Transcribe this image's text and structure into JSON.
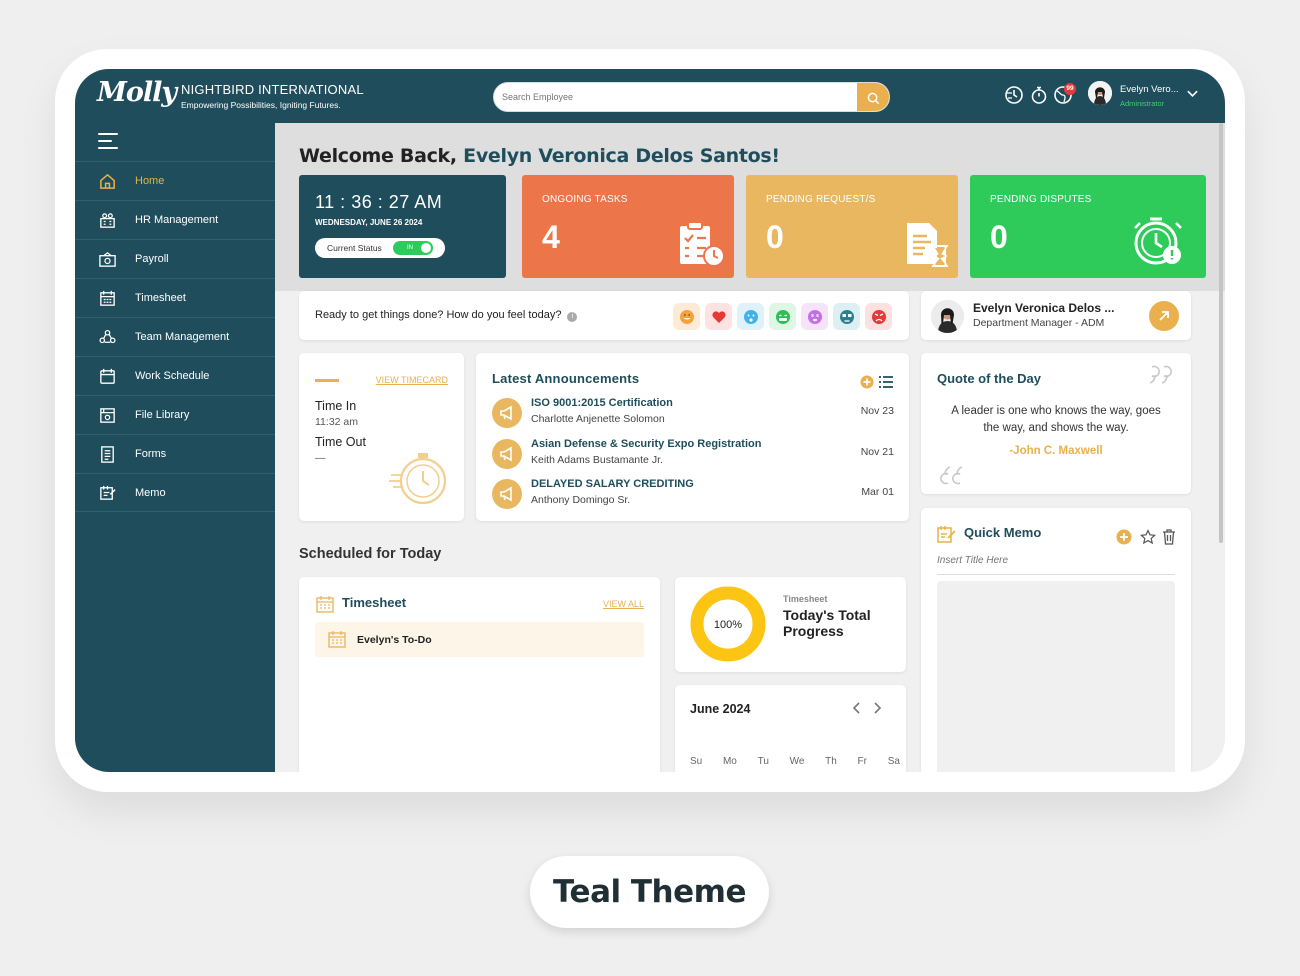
{
  "header": {
    "logo": "Molly",
    "company": "NIGHTBIRD INTERNATIONAL",
    "tagline": "Empowering Possibilities, Igniting Futures.",
    "search_placeholder": "Search Employee",
    "notification_count": "99",
    "user_name": "Evelyn Vero...",
    "user_role": "Administrator"
  },
  "sidebar": {
    "items": [
      {
        "label": "Home",
        "icon": "home-icon"
      },
      {
        "label": "HR Management",
        "icon": "hr-icon"
      },
      {
        "label": "Payroll",
        "icon": "payroll-icon"
      },
      {
        "label": "Timesheet",
        "icon": "timesheet-icon"
      },
      {
        "label": "Team Management",
        "icon": "team-icon"
      },
      {
        "label": "Work Schedule",
        "icon": "calendar-icon"
      },
      {
        "label": "File Library",
        "icon": "file-library-icon"
      },
      {
        "label": "Forms",
        "icon": "forms-icon"
      },
      {
        "label": "Memo",
        "icon": "memo-icon"
      }
    ]
  },
  "welcome": {
    "prefix": "Welcome Back,",
    "name": "Evelyn Veronica Delos Santos!"
  },
  "clock": {
    "time": "11 : 36 : 27 AM",
    "date": "WEDNESDAY, JUNE 26 2024",
    "status_label": "Current Status",
    "status_value": "IN"
  },
  "stats": {
    "tasks": {
      "label": "ONGOING TASKS",
      "value": "4"
    },
    "requests": {
      "label": "PENDING REQUEST/S",
      "value": "0"
    },
    "disputes": {
      "label": "PENDING DISPUTES",
      "value": "0"
    }
  },
  "mood": {
    "question": "Ready to get things done? How do you feel today?",
    "info": "i"
  },
  "profile": {
    "name": "Evelyn Veronica Delos ...",
    "role": "Department Manager - ADM"
  },
  "timecard": {
    "link": "VIEW TIMECARD",
    "time_in_label": "Time In",
    "time_in_value": "11:32 am",
    "time_out_label": "Time Out",
    "time_out_value": "—"
  },
  "announcements": {
    "title": "Latest Announcements",
    "items": [
      {
        "title": "ISO 9001:2015 Certification",
        "author": "Charlotte Anjenette Solomon",
        "date": "Nov 23"
      },
      {
        "title": "Asian Defense & Security Expo Registration",
        "author": "Keith Adams Bustamante Jr.",
        "date": "Nov 21"
      },
      {
        "title": "DELAYED SALARY CREDITING",
        "author": "Anthony Domingo Sr.",
        "date": "Mar 01"
      }
    ]
  },
  "quote": {
    "title": "Quote of the Day",
    "text": "A leader is one who knows the way, goes the way, and shows the way.",
    "author": "-John C. Maxwell"
  },
  "memo": {
    "title": "Quick Memo",
    "placeholder": "Insert Title Here"
  },
  "schedule": {
    "title": "Scheduled for Today",
    "timesheet_title": "Timesheet",
    "view_all": "VIEW ALL",
    "todo": "Evelyn's To-Do"
  },
  "progress": {
    "percent": 100,
    "percent_label": "100%",
    "sub": "Timesheet",
    "main": "Today's Total Progress"
  },
  "calendar": {
    "month": "June 2024",
    "days": [
      "Su",
      "Mo",
      "Tu",
      "We",
      "Th",
      "Fr",
      "Sa"
    ]
  },
  "theme_label": "Teal Theme",
  "colors": {
    "teal": "#1f4d5c",
    "accent": "#e9b04d",
    "orange": "#ec7549",
    "green": "#2ecb5a",
    "yellow": "#e9b760"
  }
}
